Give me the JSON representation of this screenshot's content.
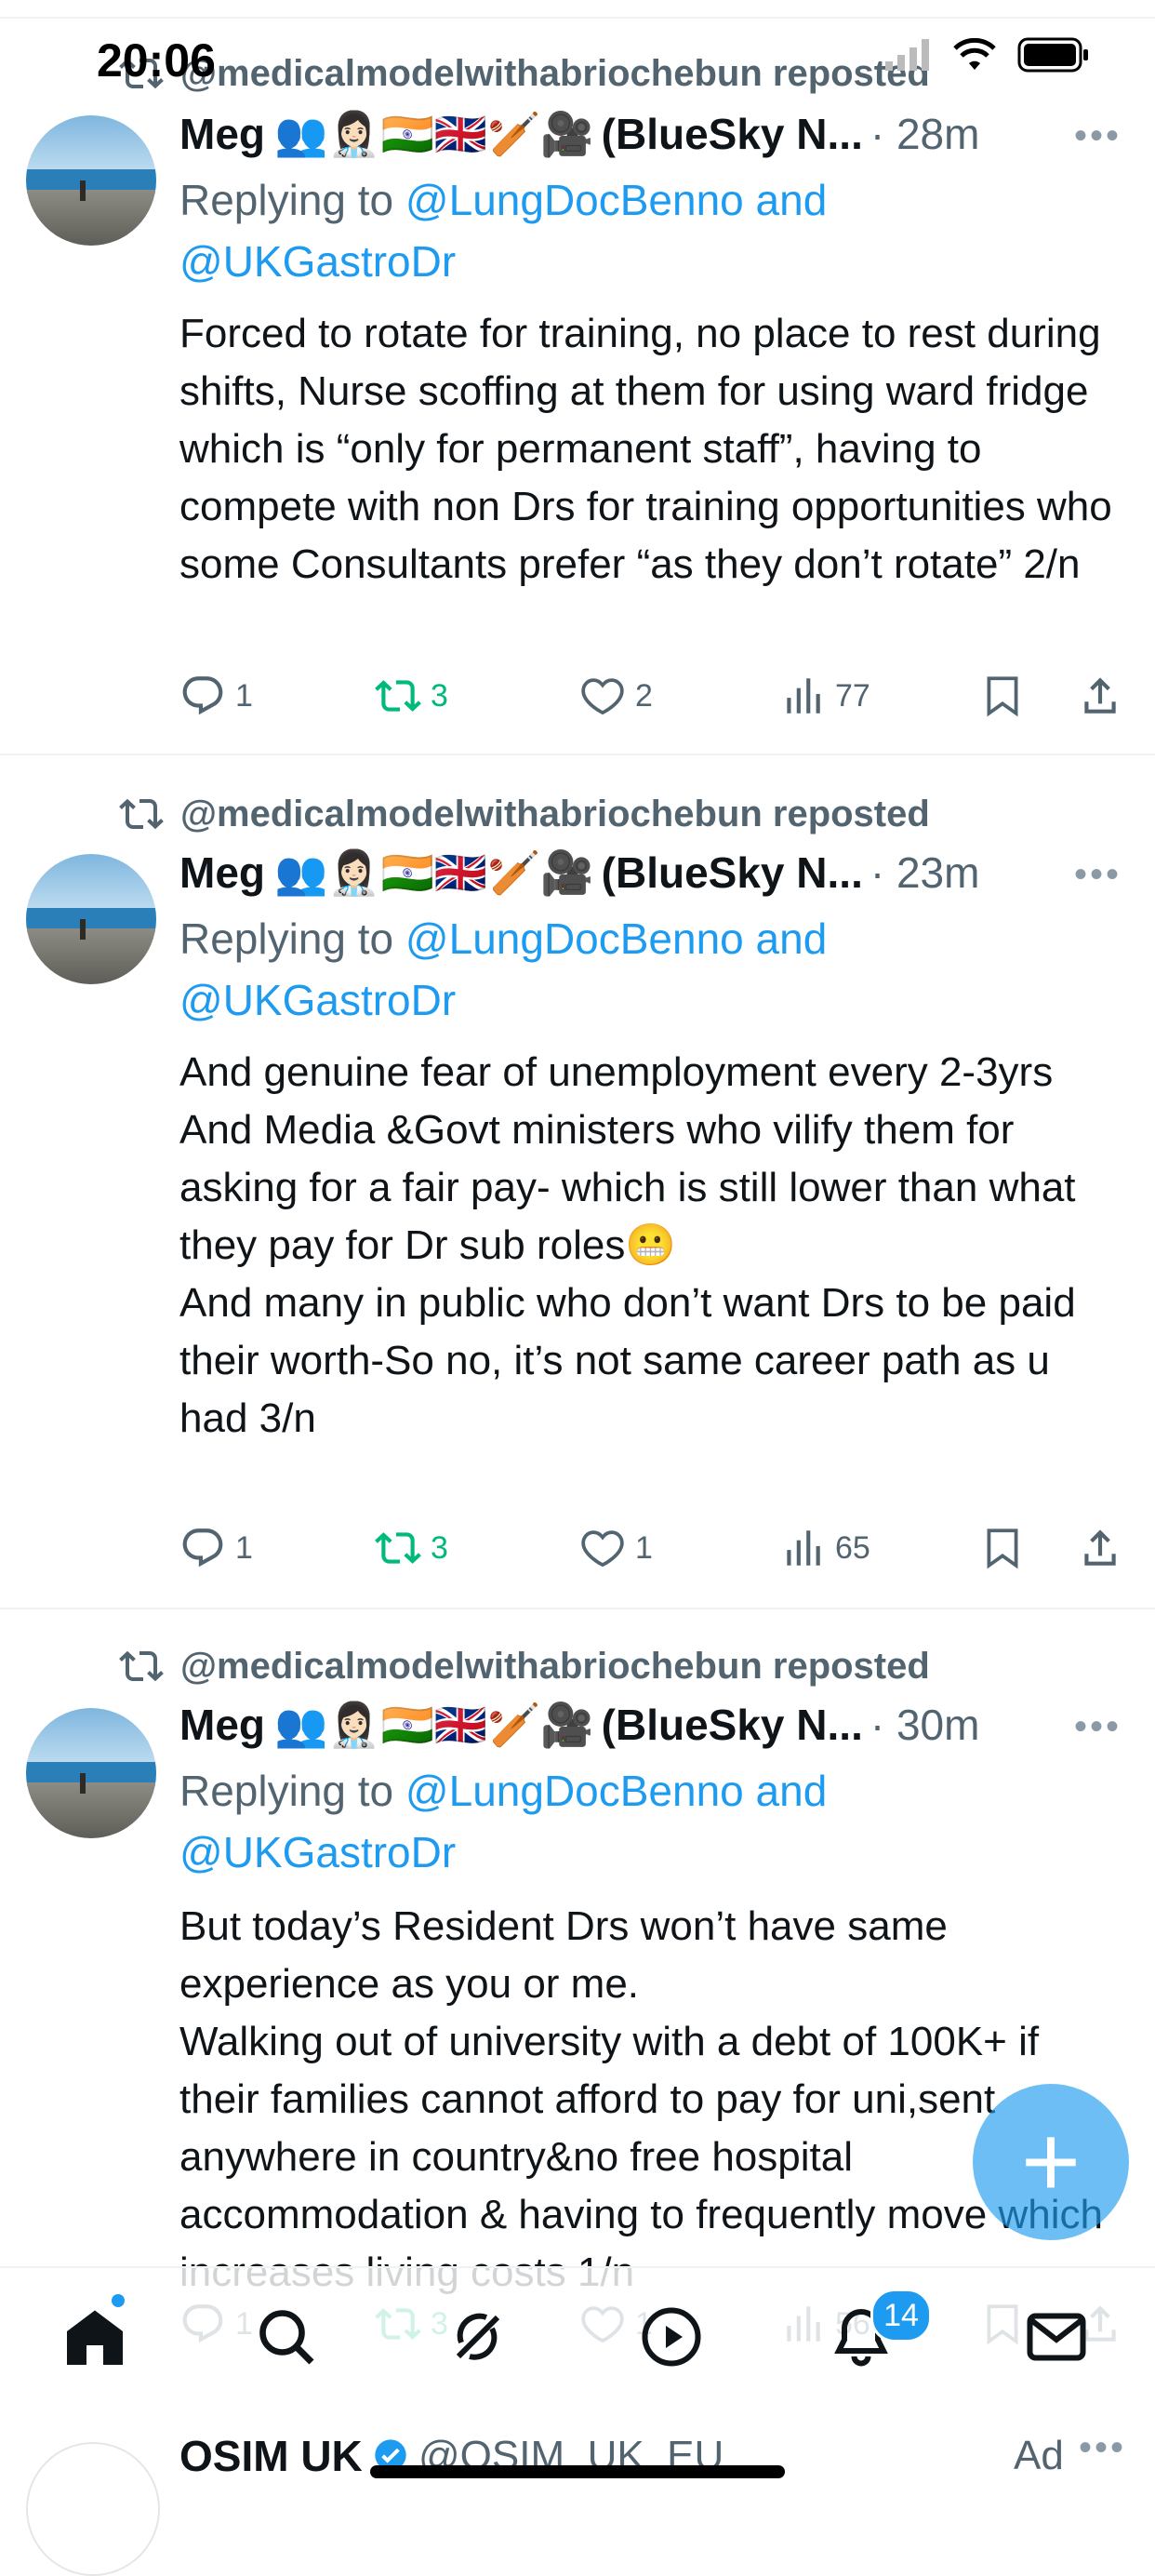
{
  "status_bar": {
    "time": "20:06"
  },
  "tweets": [
    {
      "reposted_by": "@medicalmodelwithabriochebun reposted",
      "author_name": "Meg",
      "author_emojis": "👥👩🏻‍⚕️🇮🇳🇬🇧🏏🎥",
      "author_name_suffix": "(BlueSky N...",
      "time": "· 28m",
      "reply_prefix": "Replying to ",
      "reply_handles": "@LungDocBenno and @UKGastroDr",
      "body": "Forced to rotate for training, no place to rest during shifts, Nurse scoffing at them for using ward fridge which is “only for permanent staff”, having to compete with non Drs for training opportunities who some Consultants prefer “as they don’t rotate” 2/n",
      "replies": "1",
      "reposts": "3",
      "likes": "2",
      "views": "77"
    },
    {
      "reposted_by": "@medicalmodelwithabriochebun reposted",
      "author_name": "Meg",
      "author_emojis": "👥👩🏻‍⚕️🇮🇳🇬🇧🏏🎥",
      "author_name_suffix": "(BlueSky N...",
      "time": "· 23m",
      "reply_prefix": "Replying to ",
      "reply_handles": "@LungDocBenno and @UKGastroDr",
      "body": "And genuine fear of unemployment every 2-3yrs\nAnd Media &Govt ministers who vilify them for asking for a fair pay- which is still lower than what they pay for Dr sub roles😬\nAnd many in public who don’t want Drs to be paid their worth-So no, it’s not same career path as u had 3/n",
      "replies": "1",
      "reposts": "3",
      "likes": "1",
      "views": "65"
    },
    {
      "reposted_by": "@medicalmodelwithabriochebun reposted",
      "author_name": "Meg",
      "author_emojis": "👥👩🏻‍⚕️🇮🇳🇬🇧🏏🎥",
      "author_name_suffix": "(BlueSky N...",
      "time": "· 30m",
      "reply_prefix": "Replying to ",
      "reply_handles": "@LungDocBenno and @UKGastroDr",
      "body": "But today’s Resident Drs won’t have same experience as you or me.\nWalking out of university with a debt of 100K+ if their families cannot afford to pay for uni,sent anywhere in country&no free hospital accommodation & having to frequently move which increases living costs 1/n",
      "replies": "1",
      "reposts": "3",
      "likes": "1",
      "views": "56"
    }
  ],
  "fab": {
    "label": "+"
  },
  "bottom_nav": {
    "notifications_badge": "14"
  },
  "ad": {
    "name": "OSIM UK",
    "handle": "@OSIM_UK_EU",
    "label": "Ad"
  },
  "colors": {
    "accent": "#1d9bf0",
    "repost_green": "#00ba7c",
    "muted": "#536471"
  }
}
